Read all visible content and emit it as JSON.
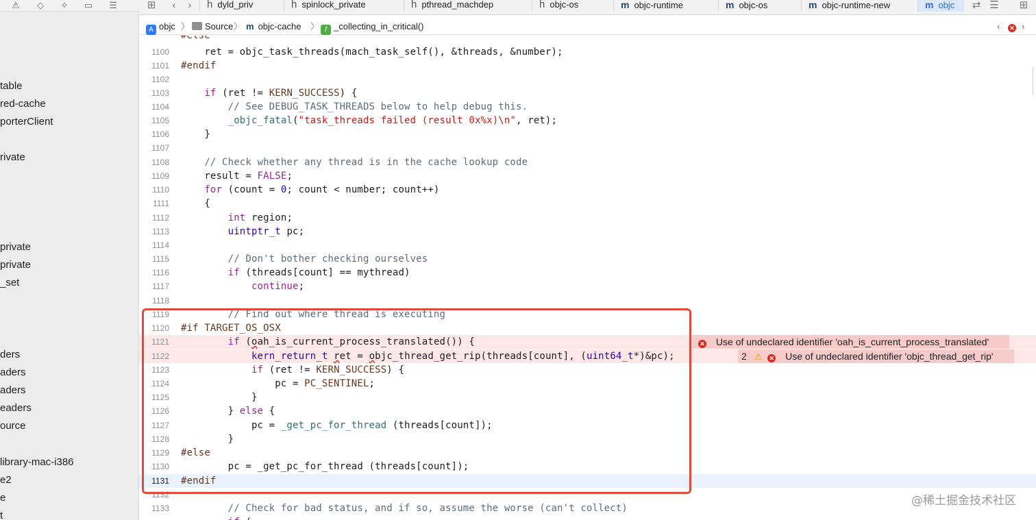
{
  "navigator": {
    "items": [
      "table",
      "red-cache",
      "porterClient",
      "rivate",
      "private",
      "private",
      "_set",
      "ders",
      "aders",
      "aders",
      "eaders",
      "ource",
      "library-mac-i386",
      "e2",
      "e",
      "t"
    ]
  },
  "tabs": [
    {
      "glyph": "h",
      "label": "dyld_priv"
    },
    {
      "glyph": "h",
      "label": "spinlock_private"
    },
    {
      "glyph": "h",
      "label": "pthread_machdep"
    },
    {
      "glyph": "h",
      "label": "objc-os"
    },
    {
      "glyph": "m",
      "label": "objc-runtime"
    },
    {
      "glyph": "m",
      "label": "objc-os"
    },
    {
      "glyph": "m",
      "label": "objc-runtime-new"
    },
    {
      "glyph": "m",
      "label": "objc"
    }
  ],
  "jumpbar": {
    "project": "objc",
    "folder": "Source",
    "file": "objc-cache",
    "function": "_collecting_in_critical()"
  },
  "code": {
    "partial_top": "#else",
    "lines": {
      "l1100": "1100",
      "l1101": "1101",
      "l1102": "1102",
      "l1103": "1103",
      "l1104": "1104",
      "l1105": "1105",
      "l1106": "1106",
      "l1107": "1107",
      "l1108": "1108",
      "l1109": "1109",
      "l1110": "1110",
      "l1111": "1111",
      "l1112": "1112",
      "l1113": "1113",
      "l1114": "1114",
      "l1115": "1115",
      "l1116": "1116",
      "l1117": "1117",
      "l1118": "1118",
      "l1119": "1119",
      "l1120": "1120",
      "l1121": "1121",
      "l1122": "1122",
      "l1123": "1123",
      "l1124": "1124",
      "l1125": "1125",
      "l1126": "1126",
      "l1127": "1127",
      "l1128": "1128",
      "l1129": "1129",
      "l1130": "1130",
      "l1131": "1131",
      "l1132": "1132",
      "l1133": "1133"
    }
  },
  "errors": {
    "e1": "Use of undeclared identifier 'oah_is_current_process_translated'",
    "e2": "Use of undeclared identifier 'objc_thread_get_rip'",
    "e2_count": "2"
  },
  "watermark": "@稀土掘金技术社区"
}
